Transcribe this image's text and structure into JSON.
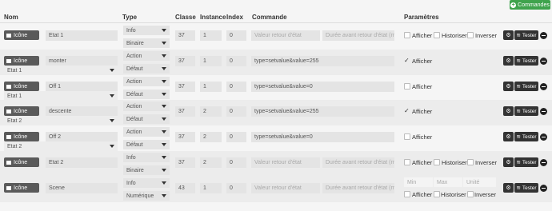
{
  "toolbar": {
    "add_label": "Commandes"
  },
  "columns": {
    "nom": "Nom",
    "type": "Type",
    "classe": "Classe",
    "instance": "Instance",
    "index": "Index",
    "commande": "Commande",
    "parametres": "Paramètres"
  },
  "labels": {
    "icone": "Icône",
    "tester": "Tester",
    "afficher": "Afficher",
    "historiser": "Historiser",
    "inverser": "Inverser",
    "valeur_retour_placeholder": "Valeur retour d'état",
    "duree_retour_placeholder": "Durée avant retour d'état (min)",
    "min_placeholder": "Min",
    "max_placeholder": "Max",
    "unite_placeholder": "Unité"
  },
  "rows": [
    {
      "name": "Etat 1",
      "type": "Info",
      "subtype": "Binaire",
      "classe": "37",
      "instance": "1",
      "index": "0",
      "commande": "",
      "kind": "info"
    },
    {
      "name": "monter",
      "link": "Etat 1",
      "type": "Action",
      "subtype": "Défaut",
      "classe": "37",
      "instance": "1",
      "index": "0",
      "commande": "type=setvalue&value=255",
      "kind": "action-checked"
    },
    {
      "name": "Off 1",
      "link": "Etat 1",
      "type": "Action",
      "subtype": "Défaut",
      "classe": "37",
      "instance": "1",
      "index": "0",
      "commande": "type=setvalue&value=0",
      "kind": "action"
    },
    {
      "name": "descente",
      "link": "Etat 2",
      "type": "Action",
      "subtype": "Défaut",
      "classe": "37",
      "instance": "2",
      "index": "0",
      "commande": "type=setvalue&value=255",
      "kind": "action-checked"
    },
    {
      "name": "Off 2",
      "link": "Etat 2",
      "type": "Action",
      "subtype": "Défaut",
      "classe": "37",
      "instance": "2",
      "index": "0",
      "commande": "type=setvalue&value=0",
      "kind": "action"
    },
    {
      "name": "Etat 2",
      "type": "Info",
      "subtype": "Binaire",
      "classe": "37",
      "instance": "2",
      "index": "0",
      "commande": "",
      "kind": "info"
    },
    {
      "name": "Scene",
      "type": "Info",
      "subtype": "Numérique",
      "classe": "43",
      "instance": "1",
      "index": "0",
      "commande": "",
      "kind": "numeric"
    }
  ]
}
